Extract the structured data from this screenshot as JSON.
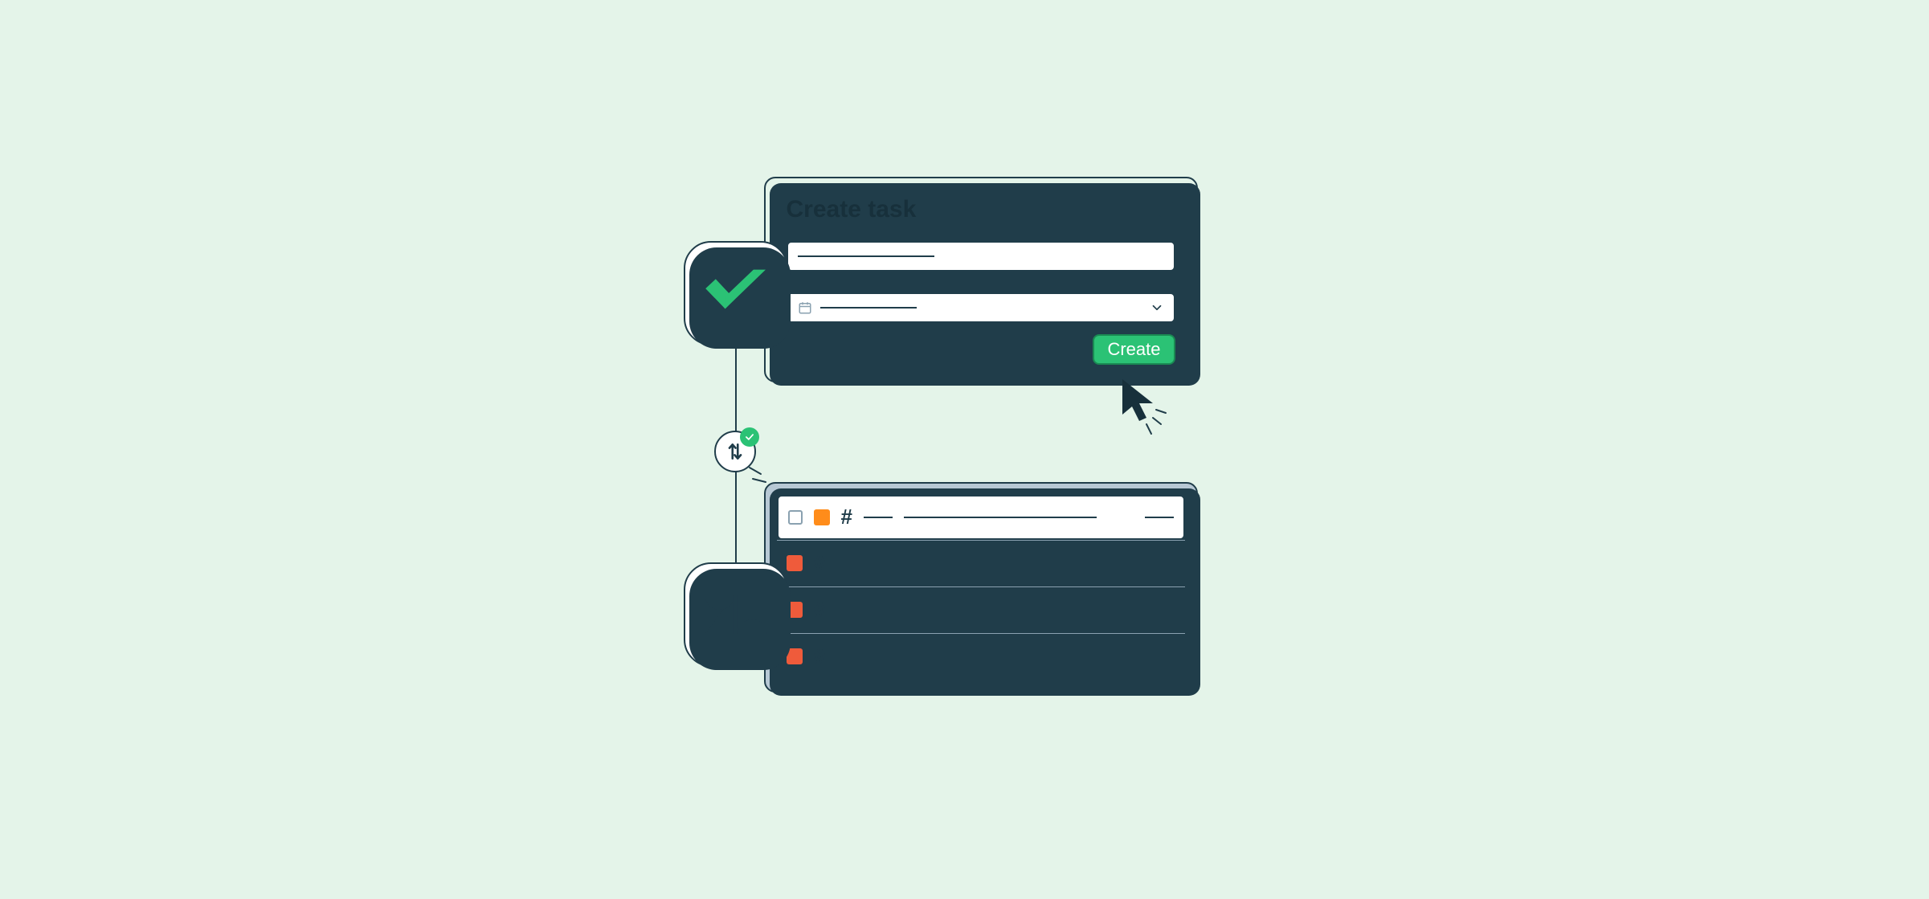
{
  "dialog": {
    "title": "Create task",
    "create_label": "Create"
  },
  "tickets": {
    "hash": "#",
    "rows": [
      {
        "priority": "orange",
        "active": true
      },
      {
        "priority": "red",
        "active": false
      },
      {
        "priority": "red",
        "active": false
      },
      {
        "priority": "red",
        "active": false
      }
    ]
  },
  "icons": {
    "wrike": "wrike-logo",
    "zendesk": "zendesk-logo",
    "sync": "sync-arrows",
    "close": "close-x",
    "chevron": "chevron-down",
    "calendar": "calendar"
  },
  "colors": {
    "accent": "#2bc275",
    "ink": "#203d4a",
    "bg": "#e4f4e9"
  }
}
